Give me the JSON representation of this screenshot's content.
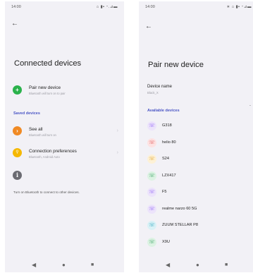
{
  "left": {
    "status_time": "14:00",
    "status_icons": "⌂ ▮▪ ⁃.⊿▬",
    "title": "Connected devices",
    "pair": {
      "label": "Pair new device",
      "sub": "Bluetooth will turn on to pair"
    },
    "saved_section": "Saved devices",
    "see_all": {
      "label": "See all",
      "sub": "Bluetooth will turn on"
    },
    "conn_prefs": {
      "label": "Connection preferences",
      "sub": "Bluetooth, Android Auto"
    },
    "footnote": "Turn on Bluetooth to connect to other devices."
  },
  "right": {
    "status_time": "14:00",
    "status_icons": "∗ ⌂ ▮▪ ⁃⊿▬",
    "title": "Pair new device",
    "device_name_label": "Device name",
    "device_name_value": "Black_X",
    "available_section": "Available devices",
    "devices": [
      {
        "name": "G318",
        "bg": "#ece3fb",
        "fg": "#8b5cf6"
      },
      {
        "name": "helio 80",
        "bg": "#fde2e2",
        "fg": "#e05252"
      },
      {
        "name": "S24",
        "bg": "#fdf1d6",
        "fg": "#e0a020"
      },
      {
        "name": "LZX417",
        "bg": "#dcf2e3",
        "fg": "#2f9e5a"
      },
      {
        "name": "F5",
        "bg": "#ece3fb",
        "fg": "#8b5cf6"
      },
      {
        "name": "realme narzo 60 5G",
        "bg": "#ece3fb",
        "fg": "#8b5cf6"
      },
      {
        "name": "ZUUM STELLAR P8",
        "bg": "#d9f1f6",
        "fg": "#2aa3bd"
      },
      {
        "name": "X9U",
        "bg": "#dcf2e3",
        "fg": "#2f9e5a"
      }
    ]
  },
  "icons": {
    "back": "←",
    "plus": "+",
    "chevron": "›",
    "collapse": "ˇ",
    "info": "i",
    "phone": "☏",
    "nav_back": "◀",
    "nav_home": "●",
    "nav_recent": "■"
  },
  "colors": {
    "pair_green": "#2bb24c",
    "see_all_orange": "#f08a24",
    "conn_yellow": "#f5b800",
    "info_gray": "#6b6b72",
    "accent": "#4a55c5"
  }
}
